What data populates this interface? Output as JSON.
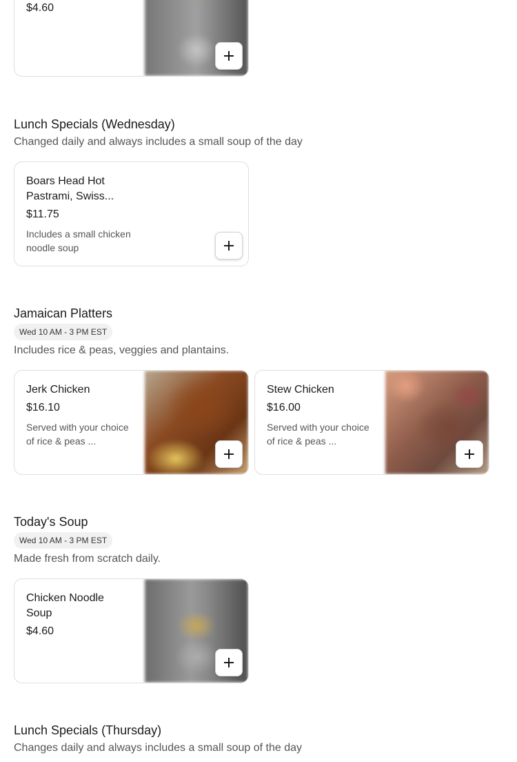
{
  "top_card": {
    "price": "$4.60",
    "image": "soup-photo"
  },
  "sections": [
    {
      "title": "Lunch Specials (Wednesday)",
      "subtitle": "Changed daily and always includes a small soup of the day",
      "items": [
        {
          "name": "Boars Head Hot Pastrami, Swiss...",
          "price": "$11.75",
          "description": "Includes a small chicken noodle soup"
        }
      ]
    },
    {
      "title": "Jamaican Platters",
      "hours": "Wed 10 AM - 3 PM EST",
      "subtitle": "Includes rice & peas, veggies and plantains.",
      "items": [
        {
          "name": "Jerk Chicken",
          "price": "$16.10",
          "description": "Served with your choice of rice & peas ...",
          "image": "jerk-chicken-photo"
        },
        {
          "name": "Stew Chicken",
          "price": "$16.00",
          "description": "Served with your choice of rice & peas ...",
          "image": "stew-chicken-photo"
        }
      ]
    },
    {
      "title": "Today's Soup",
      "hours": "Wed 10 AM - 3 PM EST",
      "subtitle": "Made fresh from scratch daily.",
      "items": [
        {
          "name": "Chicken Noodle Soup",
          "price": "$4.60",
          "image": "chicken-noodle-soup-photo"
        }
      ]
    },
    {
      "title": "Lunch Specials (Thursday)",
      "subtitle": "Changes daily and always includes a small soup of the day"
    }
  ],
  "colors": {
    "border": "#dedede",
    "muted_text": "#555555",
    "pill_bg": "#f1f1f1"
  },
  "icons": {
    "add": "plus-icon"
  }
}
